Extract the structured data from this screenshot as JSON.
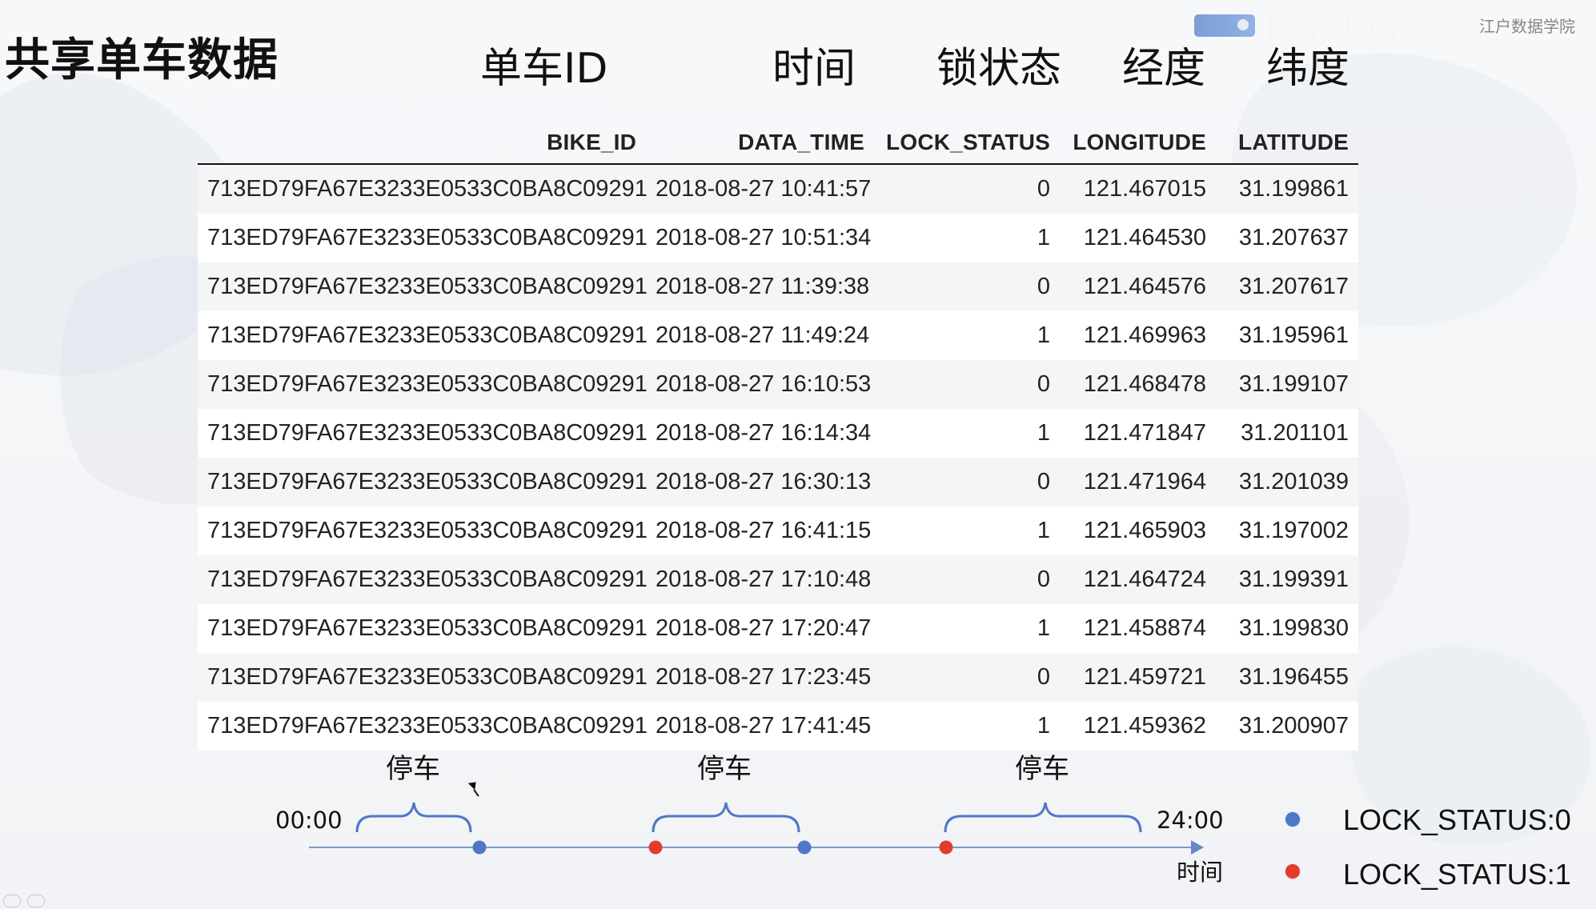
{
  "watermark": {
    "primary_text": "同济小旭学长",
    "secondary_text": "江户数据学院"
  },
  "page": {
    "title": "共享单车数据"
  },
  "cn_headers": [
    "单车ID",
    "时间",
    "锁状态",
    "经度",
    "纬度"
  ],
  "table": {
    "columns": [
      "BIKE_ID",
      "DATA_TIME",
      "LOCK_STATUS",
      "LONGITUDE",
      "LATITUDE"
    ],
    "rows": [
      [
        "713ED79FA67E3233E0533C0BA8C09291",
        "2018-08-27 10:41:57",
        "0",
        "121.467015",
        "31.199861"
      ],
      [
        "713ED79FA67E3233E0533C0BA8C09291",
        "2018-08-27 10:51:34",
        "1",
        "121.464530",
        "31.207637"
      ],
      [
        "713ED79FA67E3233E0533C0BA8C09291",
        "2018-08-27 11:39:38",
        "0",
        "121.464576",
        "31.207617"
      ],
      [
        "713ED79FA67E3233E0533C0BA8C09291",
        "2018-08-27 11:49:24",
        "1",
        "121.469963",
        "31.195961"
      ],
      [
        "713ED79FA67E3233E0533C0BA8C09291",
        "2018-08-27 16:10:53",
        "0",
        "121.468478",
        "31.199107"
      ],
      [
        "713ED79FA67E3233E0533C0BA8C09291",
        "2018-08-27 16:14:34",
        "1",
        "121.471847",
        "31.201101"
      ],
      [
        "713ED79FA67E3233E0533C0BA8C09291",
        "2018-08-27 16:30:13",
        "0",
        "121.471964",
        "31.201039"
      ],
      [
        "713ED79FA67E3233E0533C0BA8C09291",
        "2018-08-27 16:41:15",
        "1",
        "121.465903",
        "31.197002"
      ],
      [
        "713ED79FA67E3233E0533C0BA8C09291",
        "2018-08-27 17:10:48",
        "0",
        "121.464724",
        "31.199391"
      ],
      [
        "713ED79FA67E3233E0533C0BA8C09291",
        "2018-08-27 17:20:47",
        "1",
        "121.458874",
        "31.199830"
      ],
      [
        "713ED79FA67E3233E0533C0BA8C09291",
        "2018-08-27 17:23:45",
        "0",
        "121.459721",
        "31.196455"
      ],
      [
        "713ED79FA67E3233E0533C0BA8C09291",
        "2018-08-27 17:41:45",
        "1",
        "121.459362",
        "31.200907"
      ]
    ]
  },
  "timeline": {
    "start": "00:00",
    "end": "24:00",
    "axis_label": "时间",
    "parking_labels": [
      "停车",
      "停车",
      "停车"
    ]
  },
  "legend": {
    "status_0_label": "LOCK_STATUS:0",
    "status_1_label": "LOCK_STATUS:1"
  },
  "colors": {
    "blue": "#4f77c5",
    "red": "#e33b2c",
    "axis": "#6b86c7"
  }
}
